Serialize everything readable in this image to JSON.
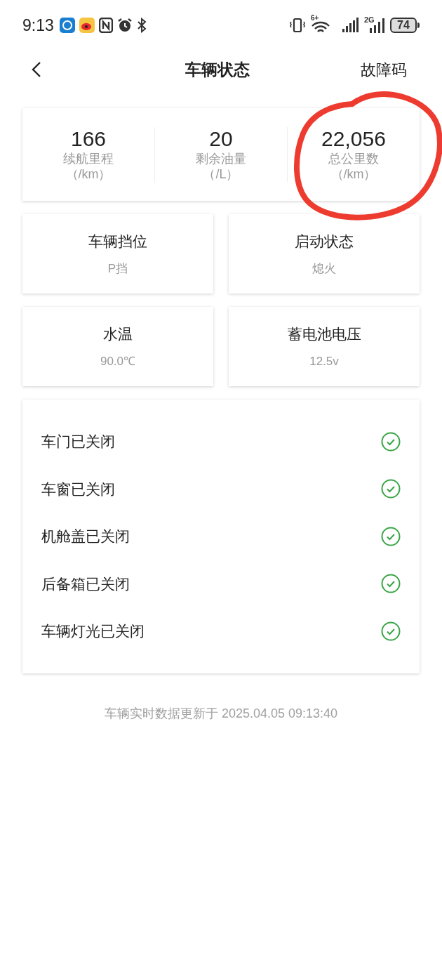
{
  "status_bar": {
    "time": "9:13",
    "battery": "74",
    "network": "2G",
    "wifi_badge": "6+"
  },
  "header": {
    "title": "车辆状态",
    "action": "故障码"
  },
  "stats": [
    {
      "value": "166",
      "label": "续航里程",
      "unit": "（/km）"
    },
    {
      "value": "20",
      "label": "剩余油量",
      "unit": "（/L）"
    },
    {
      "value": "22,056",
      "label": "总公里数",
      "unit": "（/km）"
    }
  ],
  "tiles": [
    {
      "label": "车辆挡位",
      "value": "P挡"
    },
    {
      "label": "启动状态",
      "value": "熄火"
    },
    {
      "label": "水温",
      "value": "90.0℃"
    },
    {
      "label": "蓄电池电压",
      "value": "12.5v"
    }
  ],
  "checks": [
    {
      "label": "车门已关闭",
      "ok": true
    },
    {
      "label": "车窗已关闭",
      "ok": true
    },
    {
      "label": "机舱盖已关闭",
      "ok": true
    },
    {
      "label": "后备箱已关闭",
      "ok": true
    },
    {
      "label": "车辆灯光已关闭",
      "ok": true
    }
  ],
  "footer": "车辆实时数据更新于 2025.04.05 09:13:40",
  "annotations": [
    {
      "kind": "circle"
    }
  ]
}
